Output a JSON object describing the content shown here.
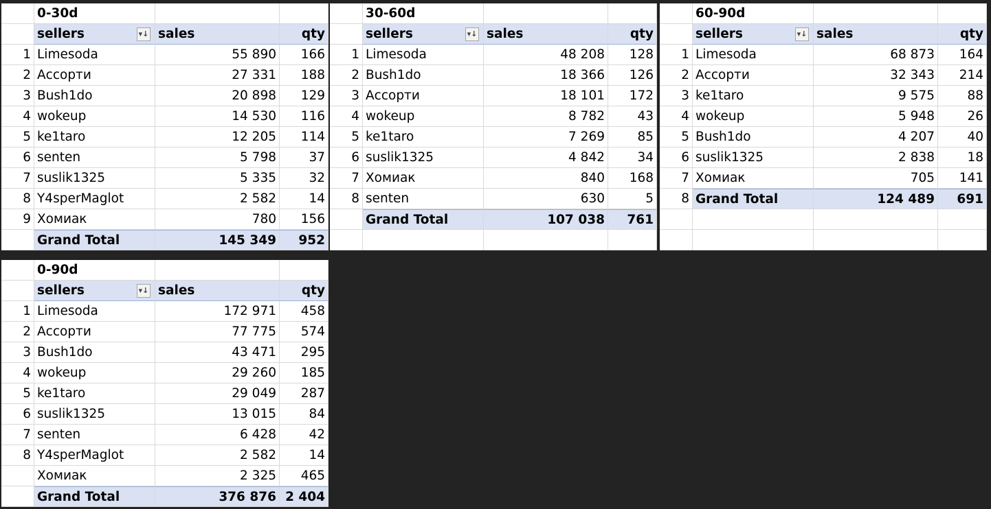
{
  "pivots": [
    {
      "id": "p0-30",
      "title": "0-30d",
      "headers": {
        "sellers": "sellers",
        "sales": "sales",
        "qty": "qty"
      },
      "filter_icon": "sort-filter-icon",
      "rows": [
        {
          "n": "1",
          "seller": "Limesoda",
          "sales": "55 890",
          "qty": "166"
        },
        {
          "n": "2",
          "seller": "Ассорти",
          "sales": "27 331",
          "qty": "188"
        },
        {
          "n": "3",
          "seller": "Bush1do",
          "sales": "20 898",
          "qty": "129"
        },
        {
          "n": "4",
          "seller": "wokeup",
          "sales": "14 530",
          "qty": "116"
        },
        {
          "n": "5",
          "seller": "ke1taro",
          "sales": "12 205",
          "qty": "114"
        },
        {
          "n": "6",
          "seller": "senten",
          "sales": "5 798",
          "qty": "37"
        },
        {
          "n": "7",
          "seller": "suslik1325",
          "sales": "5 335",
          "qty": "32"
        },
        {
          "n": "8",
          "seller": "Y4sperMaglot",
          "sales": "2 582",
          "qty": "14"
        },
        {
          "n": "9",
          "seller": "Хомиак",
          "sales": "780",
          "qty": "156"
        }
      ],
      "total": {
        "label": "Grand Total",
        "sales": "145 349",
        "qty": "952"
      },
      "empty_rows_after": 0
    },
    {
      "id": "p30-60",
      "title": "30-60d",
      "headers": {
        "sellers": "sellers",
        "sales": "sales",
        "qty": "qty"
      },
      "filter_icon": "sort-filter-icon",
      "rows": [
        {
          "n": "1",
          "seller": "Limesoda",
          "sales": "48 208",
          "qty": "128"
        },
        {
          "n": "2",
          "seller": "Bush1do",
          "sales": "18 366",
          "qty": "126"
        },
        {
          "n": "3",
          "seller": "Ассорти",
          "sales": "18 101",
          "qty": "172"
        },
        {
          "n": "4",
          "seller": "wokeup",
          "sales": "8 782",
          "qty": "43"
        },
        {
          "n": "5",
          "seller": "ke1taro",
          "sales": "7 269",
          "qty": "85"
        },
        {
          "n": "6",
          "seller": "suslik1325",
          "sales": "4 842",
          "qty": "34"
        },
        {
          "n": "7",
          "seller": "Хомиак",
          "sales": "840",
          "qty": "168"
        },
        {
          "n": "8",
          "seller": "senten",
          "sales": "630",
          "qty": "5"
        }
      ],
      "total": {
        "label": "Grand Total",
        "sales": "107 038",
        "qty": "761"
      },
      "empty_rows_after": 1
    },
    {
      "id": "p60-90",
      "title": "60-90d",
      "headers": {
        "sellers": "sellers",
        "sales": "sales",
        "qty": "qty"
      },
      "filter_icon": "sort-filter-icon",
      "rows": [
        {
          "n": "1",
          "seller": "Limesoda",
          "sales": "68 873",
          "qty": "164"
        },
        {
          "n": "2",
          "seller": "Ассорти",
          "sales": "32 343",
          "qty": "214"
        },
        {
          "n": "3",
          "seller": "ke1taro",
          "sales": "9 575",
          "qty": "88"
        },
        {
          "n": "4",
          "seller": "wokeup",
          "sales": "5 948",
          "qty": "26"
        },
        {
          "n": "5",
          "seller": "Bush1do",
          "sales": "4 207",
          "qty": "40"
        },
        {
          "n": "6",
          "seller": "suslik1325",
          "sales": "2 838",
          "qty": "18"
        },
        {
          "n": "7",
          "seller": "Хомиак",
          "sales": "705",
          "qty": "141"
        }
      ],
      "total": {
        "n": "8",
        "label": "Grand Total",
        "sales": "124 489",
        "qty": "691"
      },
      "empty_rows_after": 2
    },
    {
      "id": "p0-90",
      "title": "0-90d",
      "headers": {
        "sellers": "sellers",
        "sales": "sales",
        "qty": "qty"
      },
      "filter_icon": "sort-filter-icon",
      "rows": [
        {
          "n": "1",
          "seller": "Limesoda",
          "sales": "172 971",
          "qty": "458"
        },
        {
          "n": "2",
          "seller": "Ассорти",
          "sales": "77 775",
          "qty": "574"
        },
        {
          "n": "3",
          "seller": "Bush1do",
          "sales": "43 471",
          "qty": "295"
        },
        {
          "n": "4",
          "seller": "wokeup",
          "sales": "29 260",
          "qty": "185"
        },
        {
          "n": "5",
          "seller": "ke1taro",
          "sales": "29 049",
          "qty": "287"
        },
        {
          "n": "6",
          "seller": "suslik1325",
          "sales": "13 015",
          "qty": "84"
        },
        {
          "n": "7",
          "seller": "senten",
          "sales": "6 428",
          "qty": "42"
        },
        {
          "n": "8",
          "seller": "Y4sperMaglot",
          "sales": "2 582",
          "qty": "14"
        },
        {
          "n": "",
          "seller": "Хомиак",
          "sales": "2 325",
          "qty": "465"
        }
      ],
      "total": {
        "label": "Grand Total",
        "sales": "376 876",
        "qty": "2 404"
      },
      "empty_rows_after": 0
    }
  ],
  "colors": {
    "header_bg": "#d9e1f2",
    "background": "#232323",
    "grid": "#d9d9d9"
  }
}
